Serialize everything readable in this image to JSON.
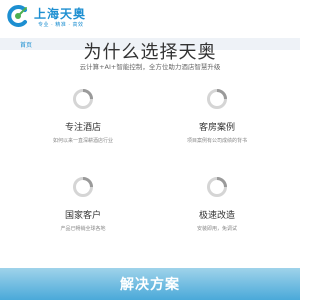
{
  "brand": {
    "name": "上海天奥",
    "slogan": "专业 · 精准 · 高效",
    "accent_color": "#1d8fd1"
  },
  "nav": {
    "home_label": "首页"
  },
  "section": {
    "title": "为什么选择天奥",
    "subtitle": "云计算+AI+智能控制，全方位助力酒店智慧升级"
  },
  "features": [
    {
      "icon": "ring-icon",
      "title": "专注酒店",
      "desc": "如何以来一直深耕酒店行业"
    },
    {
      "icon": "ring-icon",
      "title": "客房案例",
      "desc": "项目案例有公司成绩的背书"
    },
    {
      "icon": "ring-icon",
      "title": "国家客户",
      "desc": "产品已畅销全球各地"
    },
    {
      "icon": "ring-icon",
      "title": "极速改造",
      "desc": "安装即用，免调试"
    }
  ],
  "banner": {
    "title": "解决方案"
  }
}
